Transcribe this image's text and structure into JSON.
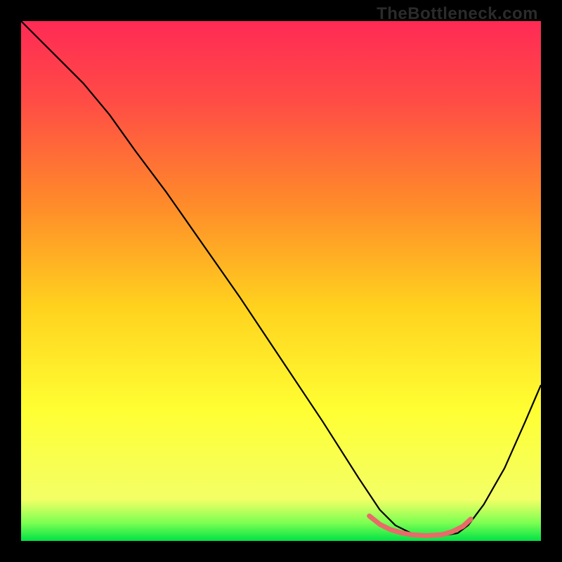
{
  "watermark": "TheBottleneck.com",
  "chart_data": {
    "type": "line",
    "title": "",
    "xlabel": "",
    "ylabel": "",
    "xlim": [
      0,
      100
    ],
    "ylim": [
      0,
      100
    ],
    "grid": false,
    "legend": false,
    "background_gradient": {
      "stops": [
        {
          "offset": 0.0,
          "color": "#ff2a55"
        },
        {
          "offset": 0.15,
          "color": "#ff4b46"
        },
        {
          "offset": 0.35,
          "color": "#ff8a2a"
        },
        {
          "offset": 0.55,
          "color": "#ffd21e"
        },
        {
          "offset": 0.75,
          "color": "#ffff33"
        },
        {
          "offset": 0.92,
          "color": "#f3ff66"
        },
        {
          "offset": 0.965,
          "color": "#7dff52"
        },
        {
          "offset": 1.0,
          "color": "#00e246"
        }
      ]
    },
    "series": [
      {
        "name": "curve",
        "stroke": "#000000",
        "stroke_width": 2.2,
        "x": [
          0,
          4,
          8,
          12,
          17,
          22,
          28,
          35,
          42,
          50,
          58,
          65,
          69,
          72,
          75,
          78,
          81,
          84,
          86,
          89,
          93,
          97,
          100
        ],
        "y": [
          100,
          96,
          92,
          88,
          82,
          75,
          67,
          57,
          47,
          35,
          23,
          12,
          6,
          3,
          1.5,
          1,
          1,
          1.5,
          3,
          7,
          14,
          23,
          30
        ]
      },
      {
        "name": "bottom-band",
        "stroke": "#e86a6a",
        "stroke_width": 7,
        "linecap": "round",
        "x": [
          67,
          69,
          71,
          73,
          75,
          78,
          81,
          83,
          85,
          86.5
        ],
        "y": [
          4.8,
          3.2,
          2.2,
          1.6,
          1.2,
          1.0,
          1.2,
          1.8,
          2.8,
          4.2
        ]
      }
    ]
  }
}
